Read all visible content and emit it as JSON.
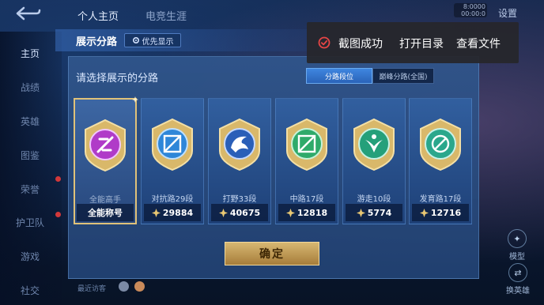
{
  "top_nav": {
    "tabs": [
      {
        "label": "个人主页",
        "active": true
      },
      {
        "label": "电竞生涯",
        "active": false
      }
    ],
    "settings_label": "设置",
    "badge_lines": [
      "8:0000",
      "00:00:0"
    ]
  },
  "sidebar": {
    "items": [
      {
        "label": "主页",
        "active": true
      },
      {
        "label": "战绩",
        "active": false
      },
      {
        "label": "英雄",
        "active": false
      },
      {
        "label": "图鉴",
        "active": false
      },
      {
        "label": "荣誉",
        "active": false
      },
      {
        "label": "护卫队",
        "active": false
      },
      {
        "label": "游戏",
        "active": false
      },
      {
        "label": "社交",
        "active": false
      }
    ]
  },
  "dialog": {
    "title": "展示分路",
    "priority_button": "优先显示",
    "prompt": "请选择展示的分路",
    "segments": [
      {
        "label": "分路段位",
        "active": true
      },
      {
        "label": "巅峰分路(全国)",
        "active": false
      }
    ],
    "cards": [
      {
        "label": "全能高手",
        "value": "全能称号",
        "selected": true,
        "icon": "all-round-badge-icon",
        "color": "#b03bc8"
      },
      {
        "label": "对抗路29段",
        "value": "29884",
        "selected": false,
        "icon": "clash-lane-badge-icon",
        "color": "#2e86d8"
      },
      {
        "label": "打野33段",
        "value": "40675",
        "selected": false,
        "icon": "jungle-badge-icon",
        "color": "#2a5fb8"
      },
      {
        "label": "中路17段",
        "value": "12818",
        "selected": false,
        "icon": "mid-lane-badge-icon",
        "color": "#2faa6a"
      },
      {
        "label": "游走10段",
        "value": "5774",
        "selected": false,
        "icon": "roam-badge-icon",
        "color": "#25a07a"
      },
      {
        "label": "发育路17段",
        "value": "12716",
        "selected": false,
        "icon": "farm-lane-badge-icon",
        "color": "#2aa78c"
      }
    ],
    "confirm_label": "确定"
  },
  "toast": {
    "message": "截图成功",
    "open_dir": "打开目录",
    "view_file": "查看文件"
  },
  "right_rail": {
    "model_label": "模型",
    "swap_label": "换英雄"
  },
  "footer": {
    "visitor_label": "最近访客"
  },
  "colors": {
    "gold": "#e0c279",
    "accent_blue": "#3f86e0",
    "toast_check": "#e64545"
  }
}
